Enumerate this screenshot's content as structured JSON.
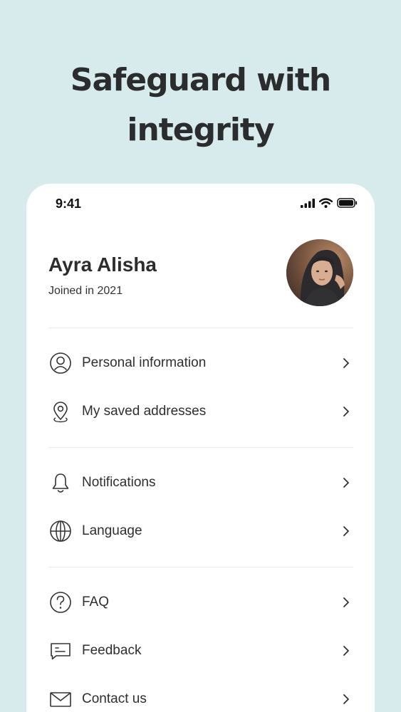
{
  "headline": {
    "line1": "Safeguard with",
    "line2": "integrity"
  },
  "status_bar": {
    "time": "9:41",
    "icons": [
      "signal-icon",
      "wifi-icon",
      "battery-icon"
    ]
  },
  "profile": {
    "name": "Ayra Alisha",
    "joined": "Joined in 2021"
  },
  "menu": {
    "account": [
      {
        "label": "Personal information",
        "icon": "user-circle-icon"
      },
      {
        "label": "My saved addresses",
        "icon": "location-pin-icon"
      }
    ],
    "preferences": [
      {
        "label": "Notifications",
        "icon": "bell-icon"
      },
      {
        "label": "Language",
        "icon": "globe-icon"
      }
    ],
    "support": [
      {
        "label": "FAQ",
        "icon": "question-circle-icon"
      },
      {
        "label": "Feedback",
        "icon": "feedback-icon"
      },
      {
        "label": "Contact us",
        "icon": "envelope-icon"
      }
    ]
  },
  "colors": {
    "background": "#d7eaec",
    "card": "#ffffff",
    "text": "#2b2b2b",
    "divider": "#ececec"
  }
}
